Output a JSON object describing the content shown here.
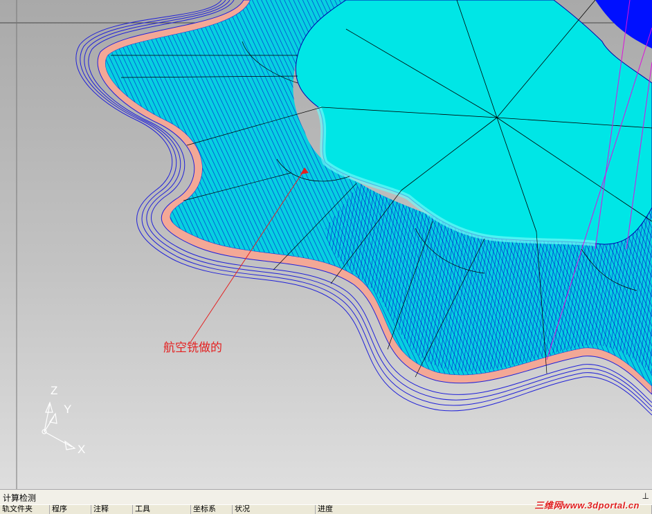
{
  "annotation": {
    "text": "航空铣做的",
    "color": "#e42020"
  },
  "axis_triad": {
    "z_label": "Z",
    "y_label": "Y",
    "x_label": "X"
  },
  "bottom_panel": {
    "title": "计算检测",
    "pin_icon": "pin-icon",
    "columns": [
      "轨文件夹",
      "程序",
      "注释",
      "工具",
      "坐标系",
      "状况",
      "进度"
    ]
  },
  "watermark": "三维网www.3dportal.cn",
  "colors": {
    "floor": "#00e5e5",
    "toolpath": "#0000cc",
    "stock_band": "#f0a090",
    "magenta_line": "#cc00cc",
    "background_top": "#a9a9a9",
    "background_bottom": "#dedede"
  }
}
